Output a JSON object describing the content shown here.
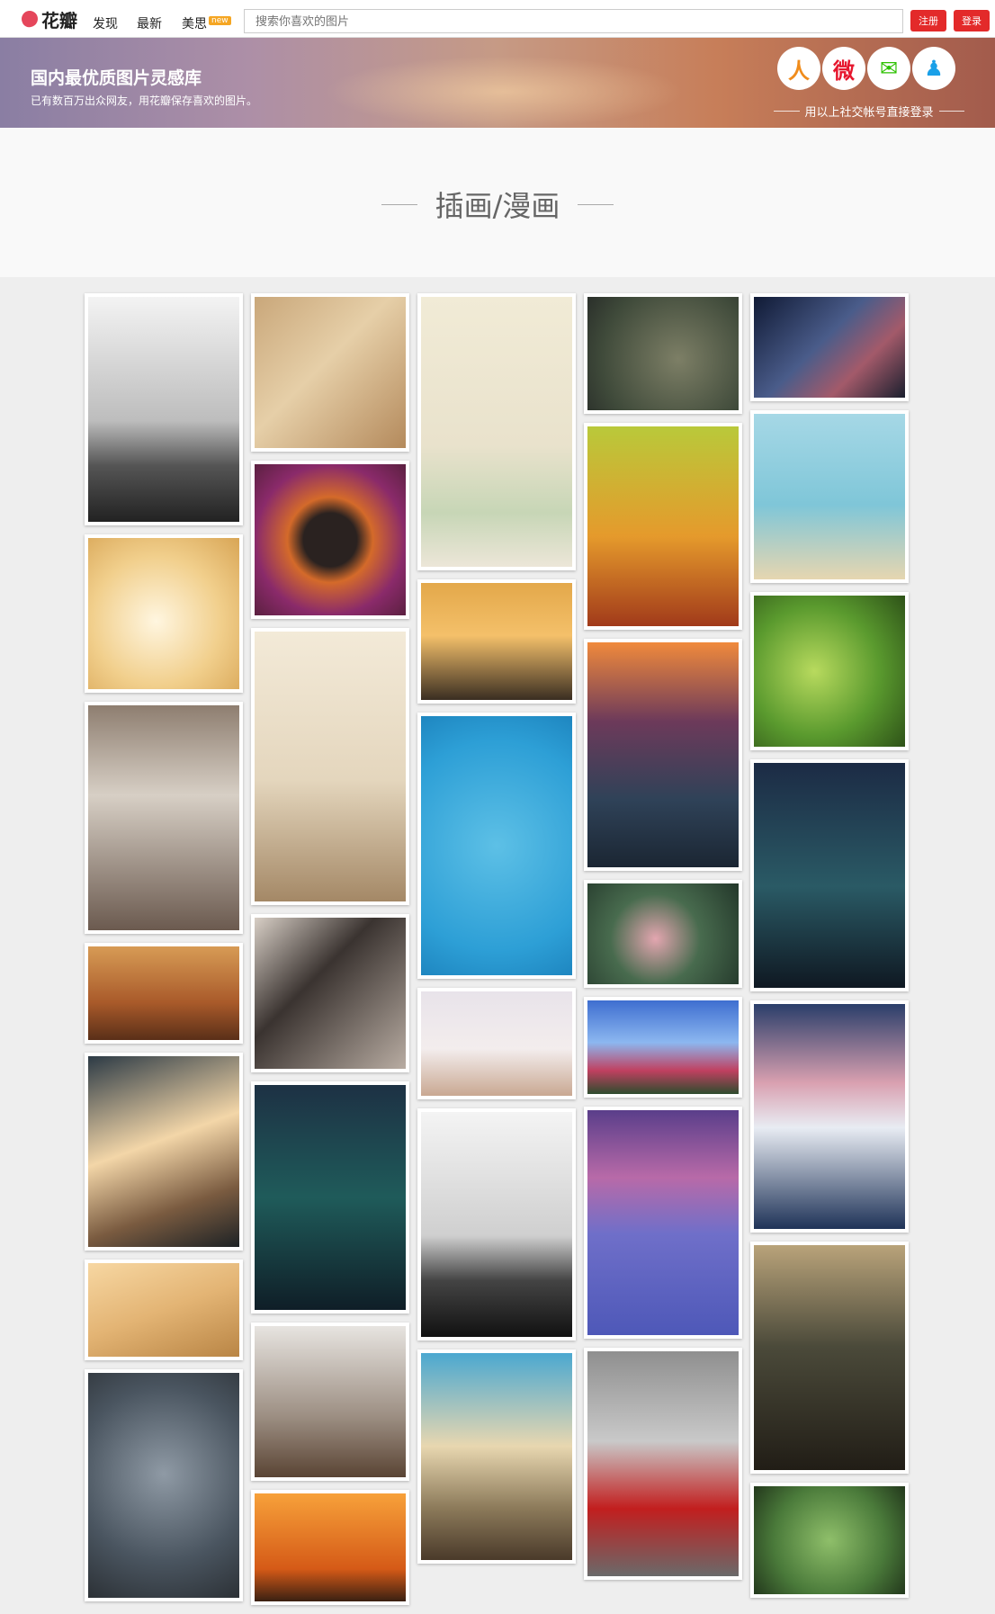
{
  "header": {
    "logo_text": "花瓣",
    "nav": [
      "发现",
      "最新",
      "美思"
    ],
    "new_badge": "new",
    "search_placeholder": "搜索你喜欢的图片",
    "register_label": "注册",
    "login_label": "登录"
  },
  "banner": {
    "title": "国内最优质图片灵感库",
    "subtitle": "已有数百万出众网友，用花瓣保存喜欢的图片。",
    "social_hint": "用以上社交帐号直接登录",
    "social": [
      {
        "name": "renren-icon",
        "glyph": "人",
        "color": "#f08c1c"
      },
      {
        "name": "weibo-icon",
        "glyph": "微",
        "color": "#e6162d"
      },
      {
        "name": "wechat-icon",
        "glyph": "✉",
        "color": "#2dc100"
      },
      {
        "name": "qq-icon",
        "glyph": "♟",
        "color": "#1aa0e8"
      }
    ]
  },
  "category": {
    "title": "插画/漫画"
  },
  "colors": {
    "accent": "#e32a2a"
  },
  "columns": [
    [
      {
        "h": 250,
        "bg": "linear-gradient(180deg,#f3f3f3 0%,#bdbdbd 55%,#555 75%,#222 100%)"
      },
      {
        "h": 168,
        "bg": "radial-gradient(circle at 45% 55%,#fff6e0,#f1cf8c 55%,#d8a555)"
      },
      {
        "h": 250,
        "bg": "linear-gradient(180deg,#8e7e70 0%,#d7cfc5 40%,#6b5a4f 100%)"
      },
      {
        "h": 104,
        "bg": "linear-gradient(180deg,#d79b55 0%,#a95a2a 60%,#5a2f18 100%)"
      },
      {
        "h": 212,
        "bg": "linear-gradient(160deg,#2c3a45 0%,#f3d6a8 45%,#7a5b40 75%,#1d2225 100%)"
      },
      {
        "h": 104,
        "bg": "linear-gradient(160deg,#f7d7a2,#e3b474 50%,#b98545)"
      },
      {
        "h": 250,
        "bg": "radial-gradient(circle at 50% 45%,#8f9aa5,#4a5560 60%,#2c3136)"
      }
    ],
    [
      {
        "h": 168,
        "bg": "linear-gradient(135deg,#c9a77a 0%,#e6cfa8 45%,#b48a5c 100%)"
      },
      {
        "h": 168,
        "bg": "radial-gradient(circle at 50% 50%,#2a2220 25%,#d46a2a 40%,#8a2a6a 70%,#5b2040 100%)"
      },
      {
        "h": 300,
        "bg": "linear-gradient(180deg,#f3ead8 0%,#e4d6bd 55%,#a48866 100%)"
      },
      {
        "h": 168,
        "bg": "linear-gradient(135deg,#d8cfc6 0%,#3a3330 40%,#b8aca2 100%)"
      },
      {
        "h": 250,
        "bg": "linear-gradient(180deg,#1d3144 0%,#1f5b5a 50%,#0f1e27 100%)"
      },
      {
        "h": 168,
        "bg": "linear-gradient(180deg,#e7e4e0 0%,#9c8e82 60%,#5a4434 100%)"
      },
      {
        "h": 120,
        "bg": "linear-gradient(180deg,#f7a13a 0%,#d55a17 70%,#3a2012 100%)"
      }
    ],
    [
      {
        "h": 300,
        "bg": "linear-gradient(180deg,#f1ebd6 0%,#e9e2cc 55%,#c7d6b6 80%,#ece6d8 100%)"
      },
      {
        "h": 130,
        "bg": "linear-gradient(180deg,#e3a84a 0%,#f4c06a 45%,#3a2e22 100%)"
      },
      {
        "h": 288,
        "bg": "radial-gradient(circle at 50% 50%,#5dc0e6,#2d9fd6 70%,#1e86c0)"
      },
      {
        "h": 116,
        "bg": "linear-gradient(180deg,#e8e3ea 0%,#f3eded 55%,#c9a892 100%)"
      },
      {
        "h": 250,
        "bg": "linear-gradient(180deg,#f4f4f4 0%,#cfcfcf 55%,#444 75%,#111 100%)"
      },
      {
        "h": 230,
        "bg": "linear-gradient(180deg,#4ba8d0 0%,#e8d7b0 45%,#8c7a5a 75%,#4a3a2a 100%)"
      }
    ],
    [
      {
        "h": 126,
        "bg": "radial-gradient(circle at 60% 55%,#7d7f66,#3f4a3a 70%,#2a2f2a)"
      },
      {
        "h": 222,
        "bg": "linear-gradient(180deg,#b9c93a 0%,#e59a2c 55%,#a13a1a 100%)"
      },
      {
        "h": 250,
        "bg": "linear-gradient(180deg,#f08a3c 0%,#6d3a5a 35%,#2f4258 70%,#1b2633 100%)"
      },
      {
        "h": 112,
        "bg": "radial-gradient(circle at 45% 55%,#e3a6b0,#486b4e 45%,#23372a)"
      },
      {
        "h": 104,
        "bg": "linear-gradient(180deg,#3e6ed0 0%,#8cb7f0 45%,#c04060 75%,#2e4c2e 100%)"
      },
      {
        "h": 250,
        "bg": "linear-gradient(180deg,#5a3e8a 0%,#b86aa8 30%,#6f6fc9 55%,#4e58b8 100%)"
      },
      {
        "h": 250,
        "bg": "linear-gradient(180deg,#8f8f8f 0%,#c9c9c9 40%,#c21e1e 70%,#6a6a6a 100%)"
      }
    ],
    [
      {
        "h": 112,
        "bg": "linear-gradient(135deg,#101a35 0%,#4a5c8a 45%,#a35a6a 70%,#1a1f2e 100%)"
      },
      {
        "h": 184,
        "bg": "linear-gradient(180deg,#a6d8e6 0%,#7fc6d8 55%,#e6d6b0 100%)"
      },
      {
        "h": 168,
        "bg": "radial-gradient(circle at 40% 50%,#b8da5e,#5a9a2e 55%,#2e5218)"
      },
      {
        "h": 250,
        "bg": "linear-gradient(180deg,#1c2b45 0%,#2a5a65 55%,#0f1822 100%)"
      },
      {
        "h": 250,
        "bg": "linear-gradient(180deg,#2a3e6a 0%,#d9a0b0 35%,#e8ecf3 55%,#1f3358 100%)"
      },
      {
        "h": 250,
        "bg": "linear-gradient(180deg,#b9a37a 0%,#4b4a3a 45%,#211d16 100%)"
      },
      {
        "h": 120,
        "bg": "radial-gradient(circle at 50% 50%,#8fbf6a,#4a7a3a 60%,#23381c)"
      }
    ]
  ]
}
